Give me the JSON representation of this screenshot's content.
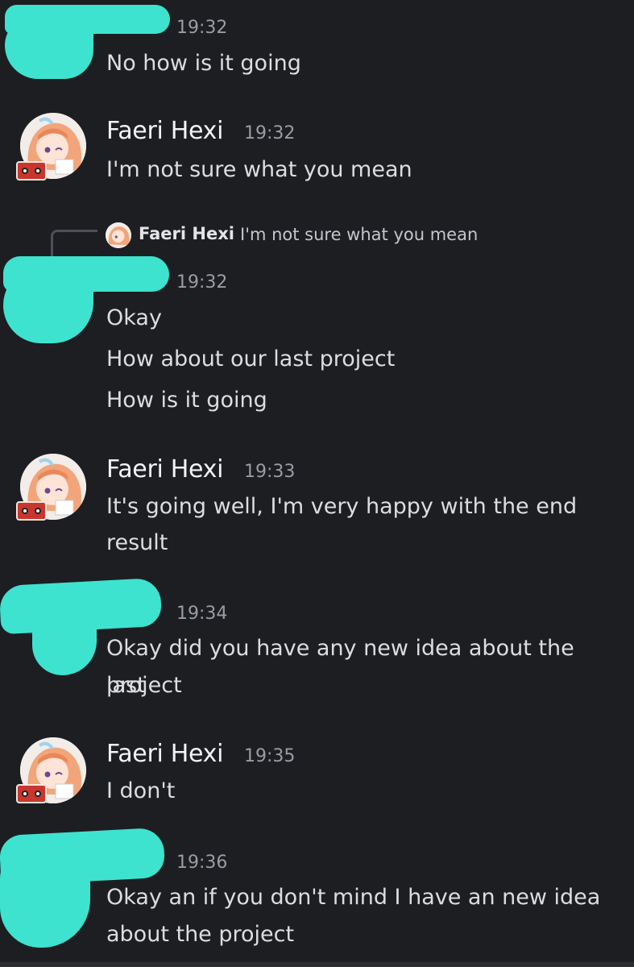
{
  "messages": [
    {
      "author": "",
      "redacted": true,
      "time": "19:32",
      "lines": [
        "No how is it going"
      ]
    },
    {
      "author": "Faeri Hexi",
      "time": "19:32",
      "lines": [
        "I'm not sure what you mean"
      ]
    },
    {
      "author": "",
      "redacted": true,
      "time": "19:32",
      "reply": {
        "author": "Faeri Hexi",
        "text": "I'm not sure what you mean"
      },
      "lines": [
        "Okay",
        "How about our last project",
        "How is it going"
      ]
    },
    {
      "author": "Faeri Hexi",
      "time": "19:33",
      "lines": [
        "It's going well, I'm very happy with the end",
        "result"
      ]
    },
    {
      "author": "",
      "redacted": true,
      "time": "19:34",
      "lines": [
        "Okay did you have any new idea about the last",
        "project"
      ]
    },
    {
      "author": "Faeri Hexi",
      "time": "19:35",
      "lines": [
        "I don't"
      ]
    },
    {
      "author": "",
      "redacted": true,
      "time": "19:36",
      "lines": [
        "Okay an if you don't mind I have an new idea",
        "about the project"
      ]
    }
  ],
  "colors": {
    "background": "#1d1e22",
    "redaction": "#3de3cf",
    "timestamp": "#9a9ca3",
    "username": "#f2f3f5"
  },
  "icons": {
    "avatar": "anime-avatar-icon",
    "badge": "cassette-badge-icon"
  }
}
